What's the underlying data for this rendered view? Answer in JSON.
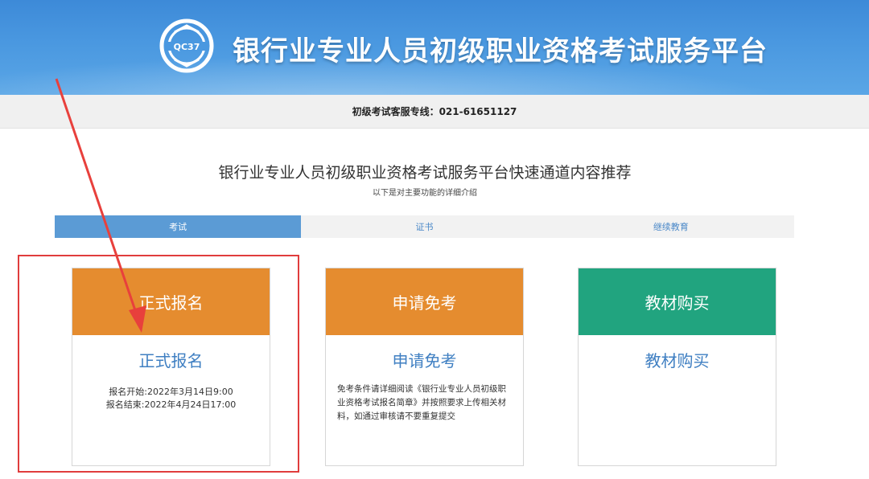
{
  "header": {
    "logo_text": "QC37",
    "title": "银行业专业人员初级职业资格考试服务平台"
  },
  "hotline": {
    "text": "初级考试客服专线：021-61651127"
  },
  "section": {
    "title": "银行业专业人员初级职业资格考试服务平台快速通道内容推荐",
    "subtitle": "以下是对主要功能的详细介绍"
  },
  "tabs": [
    {
      "label": "考试",
      "active": true
    },
    {
      "label": "证书",
      "active": false
    },
    {
      "label": "继续教育",
      "active": false
    }
  ],
  "cards": [
    {
      "head": "正式报名",
      "link": "正式报名",
      "lines": [
        "报名开始:2022年3月14日9:00",
        "报名结束:2022年4月24日17:00"
      ],
      "color": "#e58c2f"
    },
    {
      "head": "申请免考",
      "link": "申请免考",
      "lines": [
        "免考条件请详细阅读《银行业专业人员初级职业资格考试报名简章》并按照要求上传相关材料，如通过审核请不要重复提交"
      ],
      "color": "#e58c2f"
    },
    {
      "head": "教材购买",
      "link": "教材购买",
      "lines": [],
      "color": "#21a47f"
    }
  ],
  "annotation": {
    "box_color": "#e03c3c",
    "arrow_color": "#e8403c"
  }
}
